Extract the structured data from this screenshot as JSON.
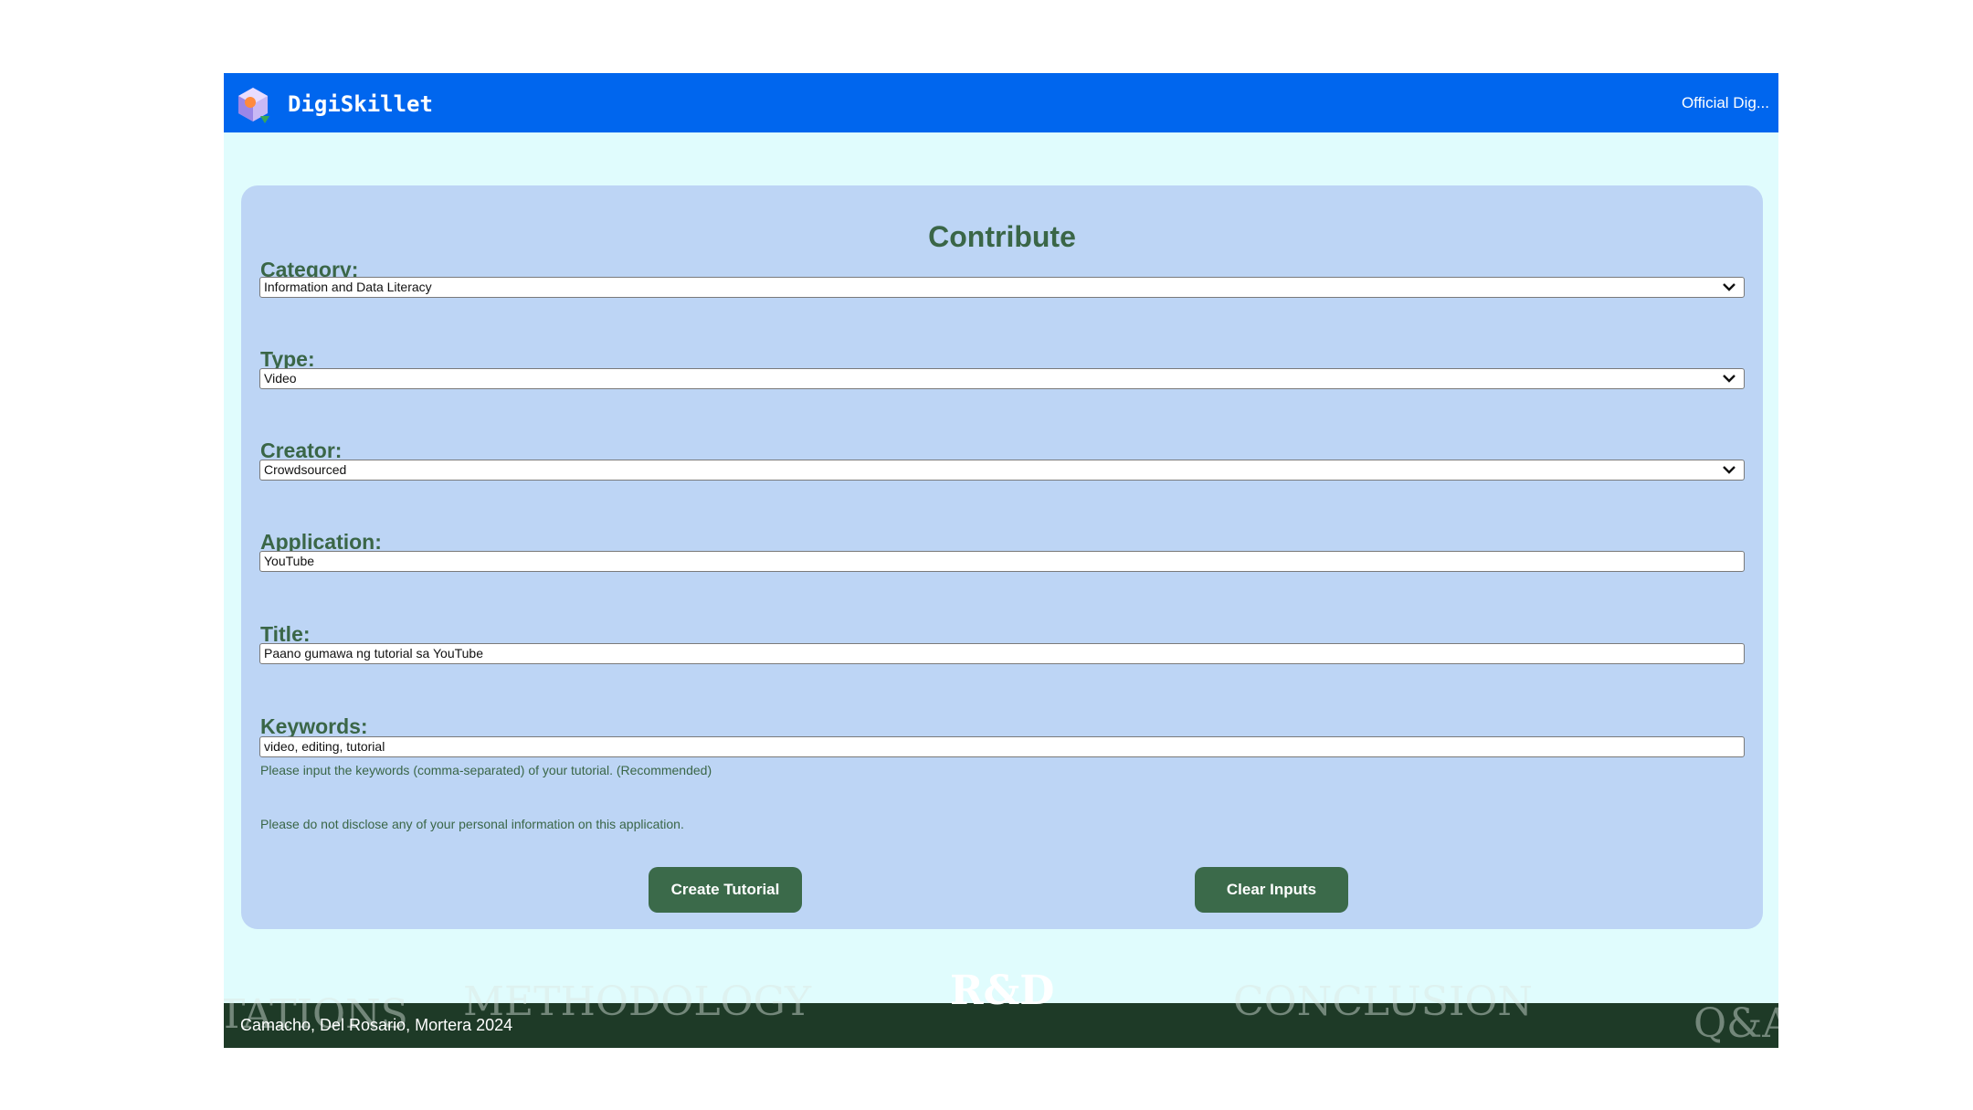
{
  "header": {
    "brand": "DigiSkillet",
    "official_label": "Official Dig..."
  },
  "form": {
    "title": "Contribute",
    "category": {
      "label": "Category:",
      "value": "Information and Data Literacy"
    },
    "type": {
      "label": "Type:",
      "value": "Video"
    },
    "creator": {
      "label": "Creator:",
      "value": "Crowdsourced"
    },
    "application": {
      "label": "Application:",
      "value": "YouTube"
    },
    "title_field": {
      "label": "Title:",
      "value": "Paano gumawa ng tutorial sa YouTube"
    },
    "keywords": {
      "label": "Keywords:",
      "value": "video, editing, tutorial",
      "hint": "Please input the keywords (comma-separated) of your tutorial. (Recommended)"
    },
    "privacy_note": "Please do not disclose any of your personal information on this application.",
    "create_button": "Create Tutorial",
    "clear_button": "Clear Inputs"
  },
  "slide_footer": {
    "nav_left_partial": "TATIONS",
    "nav_methodology": "METHODOLOGY",
    "nav_current": "R&D",
    "nav_conclusion": "CONCLUSION",
    "nav_qa": "Q&A",
    "credits": "Camacho, Del Rosario, Mortera 2024"
  },
  "colors": {
    "header_bg": "#0066ee",
    "page_bg": "#e0fcfd",
    "card_bg": "#bdd5f5",
    "accent_green": "#3a6647",
    "footer_bg": "#1e3a27"
  },
  "icons": {
    "logo": "hexagon-logo-icon",
    "dropdown": "chevron-down-icon"
  }
}
